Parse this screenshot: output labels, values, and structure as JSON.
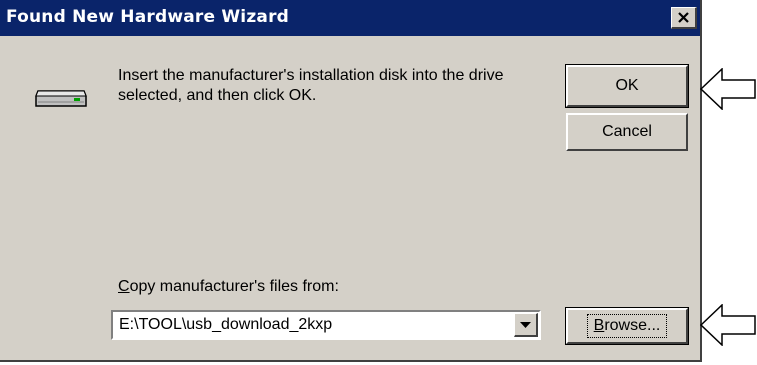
{
  "window": {
    "title": "Found New Hardware Wizard",
    "titlebar_color": "#0a246a",
    "face_color": "#d4d0c8"
  },
  "icons": {
    "close": "close-icon",
    "drive": "disk-drive-icon",
    "dropdown": "chevron-down-icon",
    "pointer": "left-arrow-icon"
  },
  "message": {
    "text": "Insert the manufacturer's installation disk into the drive selected, and then click OK."
  },
  "buttons": {
    "ok": "OK",
    "cancel": "Cancel",
    "browse_mnemonic": "B",
    "browse_rest": "rowse..."
  },
  "copy_from": {
    "label_mnemonic": "C",
    "label_rest": "opy manufacturer's files from:",
    "value": "E:\\TOOL\\usb_download_2kxp"
  }
}
